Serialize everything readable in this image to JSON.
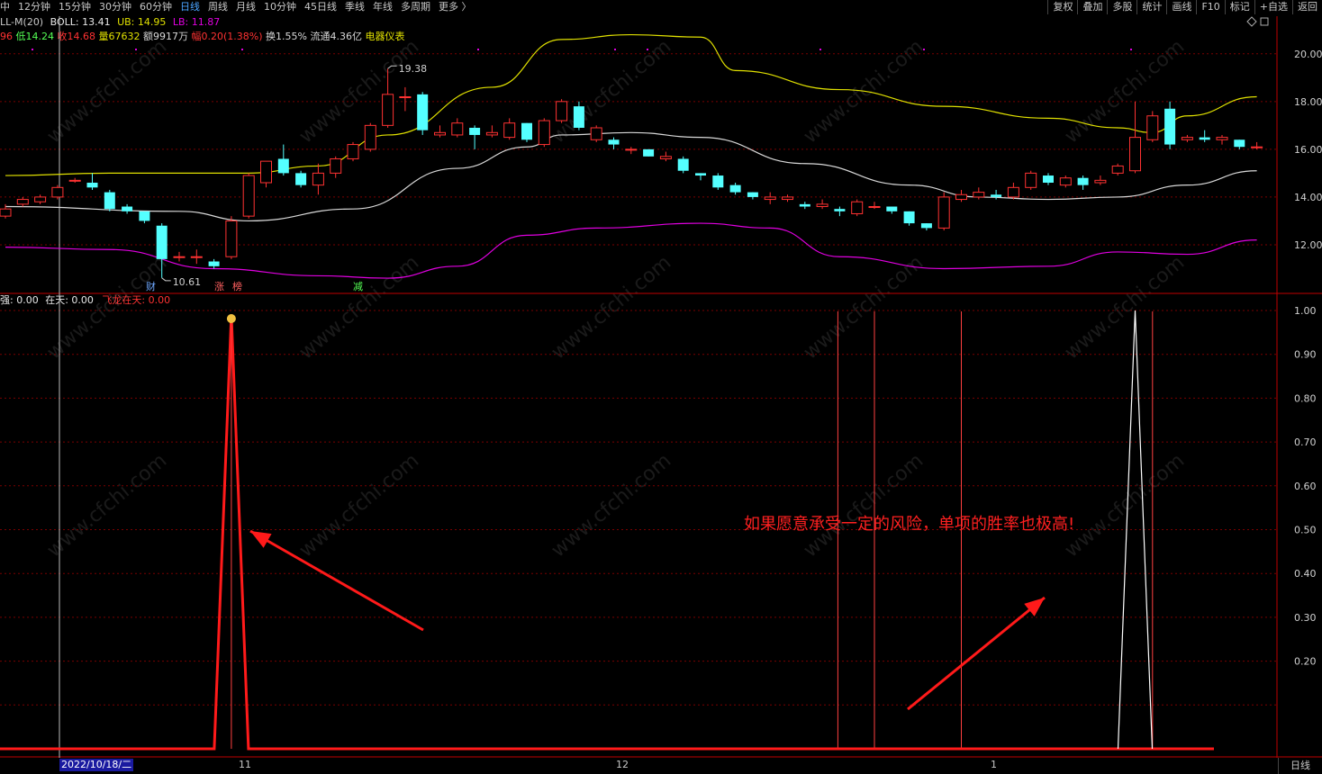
{
  "toolbar": {
    "periods": [
      "中",
      "12分钟",
      "15分钟",
      "30分钟",
      "60分钟",
      "日线",
      "周线",
      "月线",
      "10分钟",
      "45日线",
      "季线",
      "年线",
      "多周期",
      "更多 〉"
    ],
    "active_period": "日线",
    "right_buttons": [
      "复权",
      "叠加",
      "多股",
      "统计",
      "画线",
      "F10",
      "标记",
      "+自选",
      "返回"
    ]
  },
  "info": {
    "boll_name": "LL-M(20)",
    "boll_label": "BOLL: 13.41",
    "ub_label": "UB: 14.95",
    "lb_label": "LB: 11.87",
    "high_frag": "96",
    "low_label": "低14.24",
    "close_label": "收14.68",
    "vol_label": "量67632",
    "amt_label": "额9917万",
    "chg_label": "幅0.20(1.38%)",
    "turn_label": "换1.55%",
    "float_label": "流通4.36亿",
    "sector_label": "电器仪表"
  },
  "indicator_header": {
    "a": "强: 0.00",
    "b": "在天: 0.00",
    "c": "飞龙在天: 0.00"
  },
  "price_axis": [
    "20.00",
    "18.00",
    "16.00",
    "14.00",
    "12.00"
  ],
  "indicator_axis": [
    "1.00",
    "0.90",
    "0.80",
    "0.70",
    "0.60",
    "0.50",
    "0.40",
    "0.30",
    "0.20"
  ],
  "markers": {
    "high": "19.38",
    "low": "10.61",
    "tag_cai": "财",
    "tag_zhang": "涨",
    "tag_bang": "榜",
    "tag_jian": "减"
  },
  "x_axis": {
    "date_box": "2022/10/18/二",
    "m11": "11",
    "m12": "12",
    "m1": "1"
  },
  "annotation": "如果愿意承受一定的风险，单项的胜率也极高!",
  "bottom_button": "日线",
  "watermark": "www.cfchi.com",
  "colors": {
    "up": "#ff3232",
    "down": "#54ffff",
    "ub": "#e0e000",
    "mid": "#d8d8d8",
    "lb": "#e000e0",
    "grid": "#7a0000",
    "axis": "#c00000"
  },
  "chart_data": {
    "type": "candlestick",
    "candles": [
      [
        13.2,
        13.5,
        13.1,
        13.7
      ],
      [
        13.7,
        13.9,
        13.6,
        14.0
      ],
      [
        13.8,
        14.0,
        13.7,
        14.1
      ],
      [
        14.0,
        14.4,
        13.9,
        14.5
      ],
      [
        14.7,
        14.7,
        14.6,
        14.8
      ],
      [
        14.6,
        14.4,
        14.3,
        15.0
      ],
      [
        14.2,
        13.5,
        13.4,
        14.3
      ],
      [
        13.6,
        13.4,
        13.3,
        13.7
      ],
      [
        13.4,
        13.0,
        12.9,
        13.4
      ],
      [
        12.8,
        11.4,
        10.61,
        12.9
      ],
      [
        11.5,
        11.5,
        11.3,
        11.7
      ],
      [
        11.5,
        11.5,
        11.2,
        11.8
      ],
      [
        11.3,
        11.1,
        11.0,
        11.4
      ],
      [
        11.5,
        13.0,
        11.4,
        13.2
      ],
      [
        13.2,
        14.9,
        13.1,
        15.0
      ],
      [
        14.6,
        15.5,
        14.4,
        15.5
      ],
      [
        15.6,
        15.0,
        14.9,
        16.2
      ],
      [
        15.0,
        14.5,
        14.4,
        15.1
      ],
      [
        14.5,
        15.0,
        14.1,
        15.4
      ],
      [
        15.0,
        15.6,
        14.8,
        15.7
      ],
      [
        15.6,
        16.2,
        15.5,
        16.3
      ],
      [
        16.0,
        17.0,
        15.9,
        17.1
      ],
      [
        17.0,
        18.3,
        16.9,
        19.38
      ],
      [
        18.2,
        18.2,
        17.6,
        18.6
      ],
      [
        18.3,
        16.8,
        16.6,
        18.4
      ],
      [
        16.6,
        16.7,
        16.5,
        17.0
      ],
      [
        16.6,
        17.1,
        16.5,
        17.3
      ],
      [
        16.9,
        16.6,
        16.0,
        17.0
      ],
      [
        16.6,
        16.7,
        16.5,
        17.0
      ],
      [
        16.5,
        17.1,
        16.4,
        17.3
      ],
      [
        17.1,
        16.4,
        16.3,
        17.1
      ],
      [
        16.2,
        17.2,
        16.1,
        17.3
      ],
      [
        17.2,
        18.0,
        17.1,
        18.1
      ],
      [
        17.8,
        16.9,
        16.8,
        18.0
      ],
      [
        16.4,
        16.9,
        16.3,
        17.0
      ],
      [
        16.4,
        16.2,
        16.0,
        16.5
      ],
      [
        16.0,
        16.0,
        15.8,
        16.1
      ],
      [
        16.0,
        15.7,
        15.7,
        16.0
      ],
      [
        15.6,
        15.7,
        15.5,
        15.9
      ],
      [
        15.6,
        15.1,
        15.0,
        15.7
      ],
      [
        15.0,
        14.9,
        14.7,
        15.0
      ],
      [
        14.9,
        14.4,
        14.3,
        15.0
      ],
      [
        14.5,
        14.2,
        14.1,
        14.6
      ],
      [
        14.2,
        14.0,
        13.9,
        14.2
      ],
      [
        13.9,
        14.0,
        13.7,
        14.2
      ],
      [
        13.9,
        14.0,
        13.8,
        14.1
      ],
      [
        13.7,
        13.6,
        13.5,
        13.8
      ],
      [
        13.6,
        13.7,
        13.5,
        13.9
      ],
      [
        13.5,
        13.4,
        13.2,
        13.6
      ],
      [
        13.3,
        13.8,
        13.2,
        13.9
      ],
      [
        13.6,
        13.6,
        13.5,
        13.8
      ],
      [
        13.6,
        13.4,
        13.3,
        13.6
      ],
      [
        13.4,
        12.9,
        12.8,
        13.4
      ],
      [
        12.9,
        12.7,
        12.6,
        12.9
      ],
      [
        12.7,
        14.0,
        12.6,
        14.2
      ],
      [
        13.9,
        14.1,
        13.8,
        14.3
      ],
      [
        14.0,
        14.2,
        13.9,
        14.4
      ],
      [
        14.1,
        14.0,
        13.9,
        14.3
      ],
      [
        14.0,
        14.4,
        13.9,
        14.6
      ],
      [
        14.4,
        15.0,
        14.3,
        15.1
      ],
      [
        14.9,
        14.6,
        14.5,
        15.0
      ],
      [
        14.5,
        14.8,
        14.4,
        14.9
      ],
      [
        14.8,
        14.5,
        14.3,
        14.9
      ],
      [
        14.6,
        14.7,
        14.5,
        14.9
      ],
      [
        15.0,
        15.3,
        14.9,
        15.4
      ],
      [
        15.1,
        16.5,
        15.0,
        18.0
      ],
      [
        16.4,
        17.4,
        16.3,
        17.6
      ],
      [
        17.7,
        16.2,
        16.0,
        18.0
      ],
      [
        16.4,
        16.5,
        16.3,
        16.6
      ],
      [
        16.5,
        16.4,
        16.3,
        16.8
      ],
      [
        16.4,
        16.5,
        16.2,
        16.6
      ],
      [
        16.4,
        16.1,
        16.0,
        16.4
      ],
      [
        16.1,
        16.1,
        16.0,
        16.3
      ]
    ],
    "boll_mid_knots": [
      [
        0,
        13.6
      ],
      [
        10,
        13.4
      ],
      [
        14,
        13.0
      ],
      [
        20,
        13.5
      ],
      [
        26,
        15.2
      ],
      [
        30,
        16.1
      ],
      [
        32,
        16.6
      ],
      [
        36,
        16.7
      ],
      [
        40,
        16.5
      ],
      [
        46,
        15.4
      ],
      [
        52,
        14.5
      ],
      [
        56,
        14.0
      ],
      [
        60,
        13.9
      ],
      [
        64,
        14.0
      ],
      [
        68,
        14.5
      ],
      [
        72,
        15.1
      ]
    ],
    "boll_ub_knots": [
      [
        0,
        14.9
      ],
      [
        6,
        15.0
      ],
      [
        14,
        15.0
      ],
      [
        18,
        15.3
      ],
      [
        22,
        16.6
      ],
      [
        28,
        18.6
      ],
      [
        32,
        20.6
      ],
      [
        36,
        20.8
      ],
      [
        40,
        20.7
      ],
      [
        42,
        19.3
      ],
      [
        48,
        18.5
      ],
      [
        54,
        17.8
      ],
      [
        60,
        17.3
      ],
      [
        64,
        16.9
      ],
      [
        66,
        16.7
      ],
      [
        68,
        17.4
      ],
      [
        72,
        18.2
      ]
    ],
    "boll_lb_knots": [
      [
        0,
        11.9
      ],
      [
        6,
        11.8
      ],
      [
        12,
        11.0
      ],
      [
        18,
        10.7
      ],
      [
        22,
        10.6
      ],
      [
        26,
        11.1
      ],
      [
        30,
        12.4
      ],
      [
        34,
        12.7
      ],
      [
        40,
        12.9
      ],
      [
        44,
        12.7
      ],
      [
        48,
        11.5
      ],
      [
        54,
        11.0
      ],
      [
        60,
        11.1
      ],
      [
        64,
        11.7
      ],
      [
        68,
        11.6
      ],
      [
        72,
        12.2
      ]
    ],
    "signal_spikes": [
      {
        "bar": 13,
        "value": 0.99
      },
      {
        "bar": 65,
        "value": 1.0
      }
    ],
    "signal_lines": [
      48,
      50,
      55,
      66
    ],
    "price_ylim": [
      10.0,
      21.5
    ],
    "indicator_ylim": [
      0.0,
      1.0
    ]
  }
}
